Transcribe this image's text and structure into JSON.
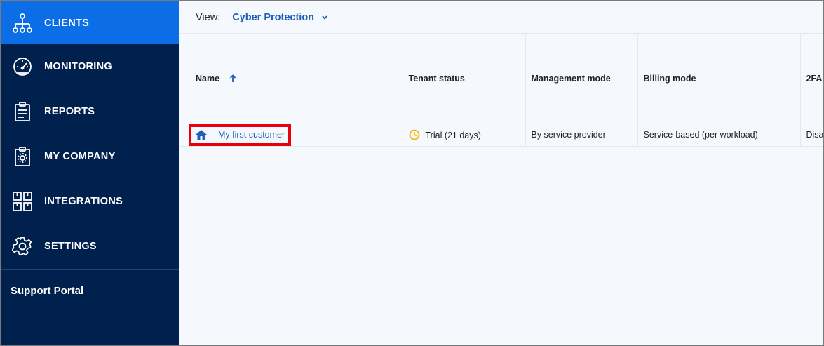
{
  "sidebar": {
    "items": [
      {
        "label": "CLIENTS",
        "icon": "clients-icon",
        "active": true
      },
      {
        "label": "MONITORING",
        "icon": "speedometer-icon",
        "active": false
      },
      {
        "label": "REPORTS",
        "icon": "clipboard-icon",
        "active": false
      },
      {
        "label": "MY COMPANY",
        "icon": "company-gear-icon",
        "active": false
      },
      {
        "label": "INTEGRATIONS",
        "icon": "integrations-grid-icon",
        "active": false
      },
      {
        "label": "SETTINGS",
        "icon": "gear-icon",
        "active": false
      }
    ],
    "support_label": "Support Portal"
  },
  "viewbar": {
    "label": "View:",
    "selected": "Cyber Protection"
  },
  "table": {
    "columns": [
      "Name",
      "Tenant status",
      "Management mode",
      "Billing mode",
      "2FA"
    ],
    "rows": [
      {
        "name": "My first customer",
        "tenant_status": "Trial (21 days)",
        "management_mode": "By service provider",
        "billing_mode": "Service-based (per workload)",
        "twofa": "Disabled"
      }
    ]
  },
  "colors": {
    "sidebar_bg": "#00204d",
    "active_bg": "#0b6ee6",
    "link": "#1f5fb5",
    "highlight": "#e8000b",
    "trial_clock": "#f2b600"
  }
}
